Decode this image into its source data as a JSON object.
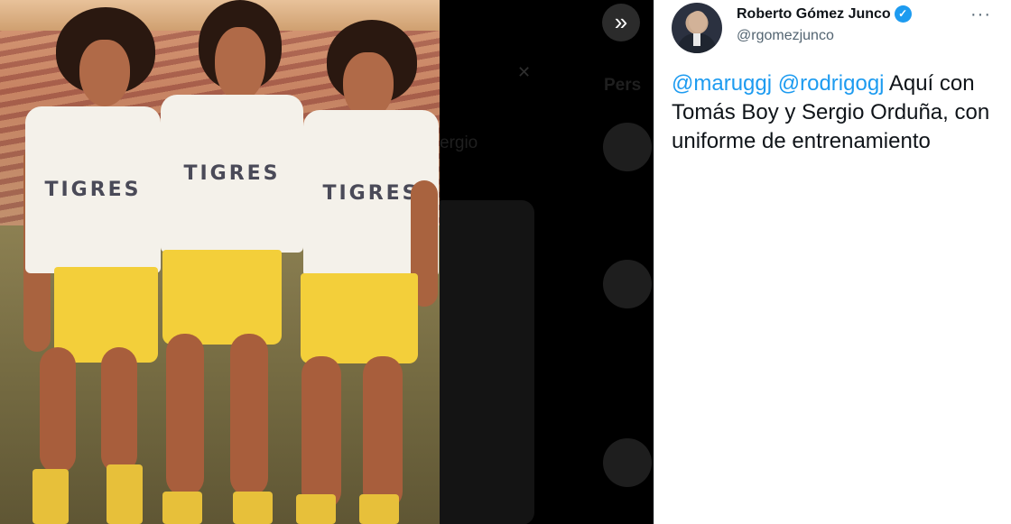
{
  "tweet": {
    "author_name": "Roberto Gómez Junco",
    "author_handle": "@rgomezjunco",
    "verified_glyph": "✓",
    "more_label": "···",
    "mention_1": "@maruggj",
    "mention_2": "@rodrigogj",
    "body_text": " Aquí con Tomás Boy y Sergio Orduña, con uniforme de entrenamiento"
  },
  "photo": {
    "shirt_text": "TIGRES"
  },
  "background": {
    "heading_fragment": "Pers",
    "text_fragment": "ergio",
    "close_glyph": "✕"
  },
  "viewer": {
    "expand_glyph": "»"
  },
  "colors": {
    "link": "#1d9bf0",
    "verified": "#1d9bf0",
    "text_primary": "#0f1419",
    "text_secondary": "#536471",
    "shorts": "#f3cf3a"
  }
}
